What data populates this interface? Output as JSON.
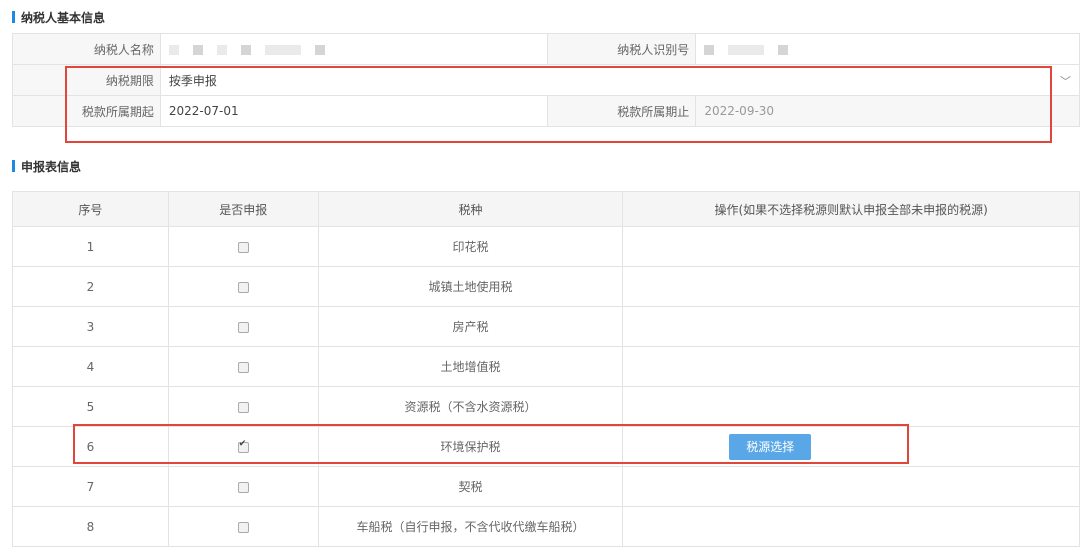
{
  "section1": {
    "title": "纳税人基本信息"
  },
  "info": {
    "name_label": "纳税人名称",
    "id_label": "纳税人识别号",
    "period_label": "纳税期限",
    "period_value": "按季申报",
    "start_label": "税款所属期起",
    "start_value": "2022-07-01",
    "end_label": "税款所属期止",
    "end_value": "2022-09-30"
  },
  "section2": {
    "title": "申报表信息"
  },
  "table": {
    "headers": [
      "序号",
      "是否申报",
      "税种",
      "操作(如果不选择税源则默认申报全部未申报的税源)"
    ],
    "rows": [
      {
        "no": "1",
        "tax": "印花税",
        "checked": false
      },
      {
        "no": "2",
        "tax": "城镇土地使用税",
        "checked": false
      },
      {
        "no": "3",
        "tax": "房产税",
        "checked": false
      },
      {
        "no": "4",
        "tax": "土地增值税",
        "checked": false
      },
      {
        "no": "5",
        "tax": "资源税（不含水资源税）",
        "checked": false
      },
      {
        "no": "6",
        "tax": "环境保护税",
        "checked": true,
        "button": "税源选择"
      },
      {
        "no": "7",
        "tax": "契税",
        "checked": false
      },
      {
        "no": "8",
        "tax": "车船税（自行申报，不含代收代缴车船税）",
        "checked": false
      }
    ]
  },
  "colors": {
    "accent": "#1e88e5",
    "button": "#5aa7e8",
    "highlight": "#e0463a"
  }
}
